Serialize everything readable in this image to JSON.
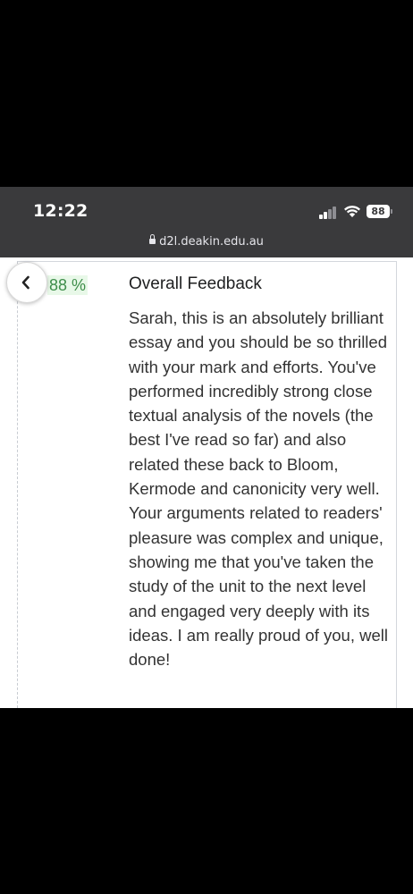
{
  "status_bar": {
    "time": "12:22",
    "battery": "88",
    "signal_icon": "cellular-signal-icon",
    "wifi_icon": "wifi-icon"
  },
  "browser": {
    "url": "d2l.deakin.edu.au",
    "lock_icon": "lock-icon"
  },
  "navigation": {
    "back_icon": "chevron-left-icon"
  },
  "feedback": {
    "grade": "88 %",
    "grade_color": "#3e8e4a",
    "grade_background": "#e8f8e8",
    "title": "Overall Feedback",
    "body": "Sarah, this is an absolutely brilliant essay and you should be so thrilled with your mark and efforts. You've performed incredibly strong close textual analysis of the novels (the best I've read so far) and also related these back to Bloom, Kermode and canonicity very well. Your arguments related to readers' pleasure was complex and unique, showing me that you've taken the study of the unit to the next level and engaged very deeply with its ideas. I am really proud of you, well done!"
  }
}
